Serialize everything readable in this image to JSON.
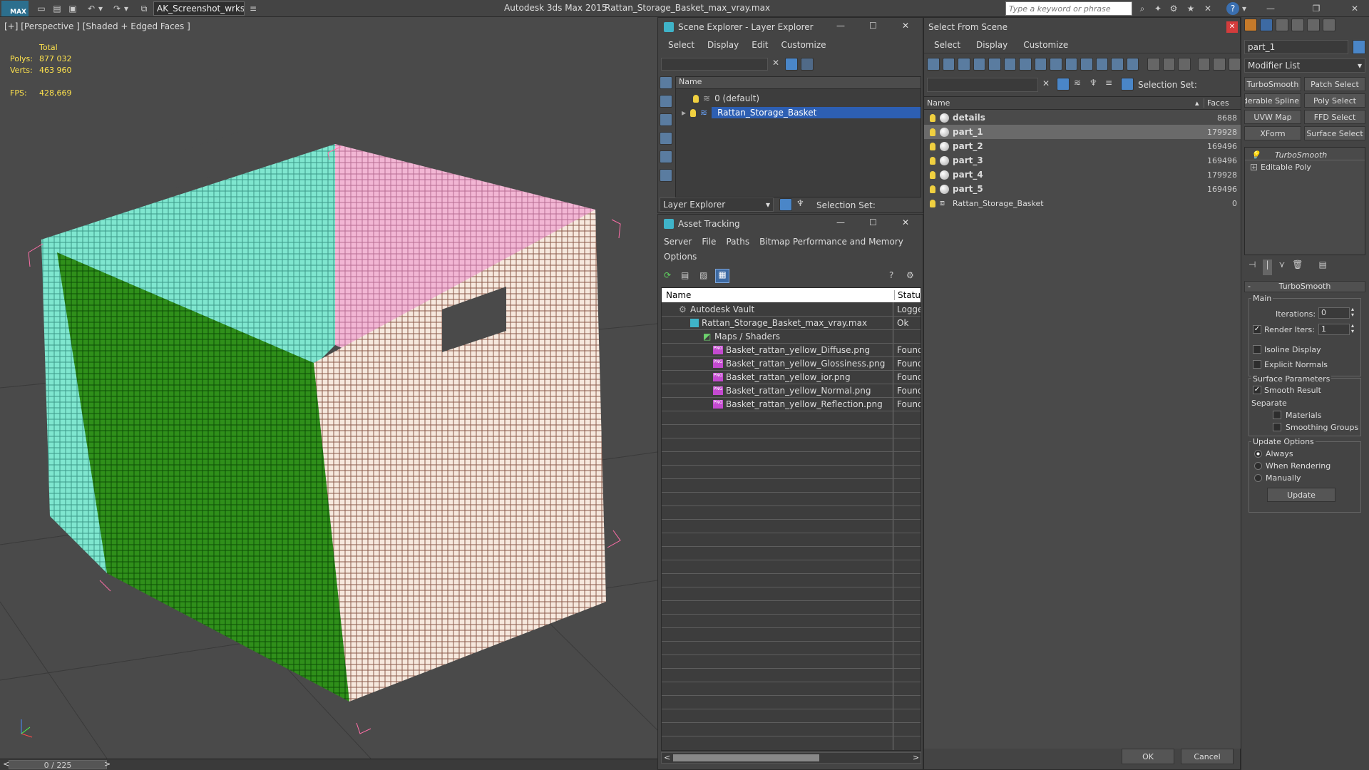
{
  "app": {
    "title": "Autodesk 3ds Max  2015",
    "file": "Rattan_Storage_Basket_max_vray.max",
    "workspace": "AK_Screenshot_wrksp",
    "search_placeholder": "Type a keyword or phrase",
    "logo": "MAX"
  },
  "viewport": {
    "label": "[+] [Perspective ] [Shaded + Edged Faces ]",
    "stats": {
      "total_label": "Total",
      "polys_label": "Polys:",
      "polys": "877 032",
      "verts_label": "Verts:",
      "verts": "463 960",
      "fps_label": "FPS:",
      "fps": "428,669"
    },
    "timeline": "0 / 225"
  },
  "scene_explorer": {
    "title": "Scene Explorer - Layer Explorer",
    "menu": [
      "Select",
      "Display",
      "Edit",
      "Customize"
    ],
    "col_name": "Name",
    "rows": [
      "0 (default)",
      "Rattan_Storage_Basket"
    ],
    "footer_label": "Layer Explorer",
    "selection_set": "Selection Set:"
  },
  "asset_tracking": {
    "title": "Asset Tracking",
    "menu": [
      "Server",
      "File",
      "Paths",
      "Bitmap Performance and Memory",
      "Options"
    ],
    "col_name": "Name",
    "col_status": "Status",
    "rows": [
      {
        "name": "Autodesk Vault",
        "status": "Logged"
      },
      {
        "name": "Rattan_Storage_Basket_max_vray.max",
        "status": "Ok"
      },
      {
        "name": "Maps / Shaders",
        "status": ""
      },
      {
        "name": "Basket_rattan_yellow_Diffuse.png",
        "status": "Found"
      },
      {
        "name": "Basket_rattan_yellow_Glossiness.png",
        "status": "Found"
      },
      {
        "name": "Basket_rattan_yellow_ior.png",
        "status": "Found"
      },
      {
        "name": "Basket_rattan_yellow_Normal.png",
        "status": "Found"
      },
      {
        "name": "Basket_rattan_yellow_Reflection.png",
        "status": "Found"
      }
    ]
  },
  "select_from_scene": {
    "title": "Select From Scene",
    "menu": [
      "Select",
      "Display",
      "Customize"
    ],
    "selection_set": "Selection Set:",
    "col_name": "Name",
    "col_faces": "Faces",
    "rows": [
      {
        "name": "details",
        "faces": "8688"
      },
      {
        "name": "part_1",
        "faces": "179928"
      },
      {
        "name": "part_2",
        "faces": "169496"
      },
      {
        "name": "part_3",
        "faces": "169496"
      },
      {
        "name": "part_4",
        "faces": "179928"
      },
      {
        "name": "part_5",
        "faces": "169496"
      },
      {
        "name": "Rattan_Storage_Basket",
        "faces": "0"
      }
    ],
    "ok": "OK",
    "cancel": "Cancel"
  },
  "command_panel": {
    "object_name": "part_1",
    "modifier_list": "Modifier List",
    "mod_buttons": [
      "TurboSmooth",
      "Patch Select",
      "Renderable Spline",
      "Poly Select",
      "UVW Map",
      "FFD Select",
      "XForm",
      "Surface Select"
    ],
    "stack": [
      "TurboSmooth",
      "Editable Poly"
    ],
    "rollout_title": "TurboSmooth",
    "main_label": "Main",
    "iterations_label": "Iterations:",
    "iterations": "0",
    "render_iters_label": "Render Iters:",
    "render_iters": "1",
    "isoline": "Isoline Display",
    "explicit_normals": "Explicit Normals",
    "surface_params": "Surface Parameters",
    "smooth_result": "Smooth Result",
    "separate": "Separate",
    "materials": "Materials",
    "smoothing_groups": "Smoothing Groups",
    "update_options": "Update Options",
    "always": "Always",
    "when_rendering": "When Rendering",
    "manually": "Manually",
    "update": "Update"
  }
}
